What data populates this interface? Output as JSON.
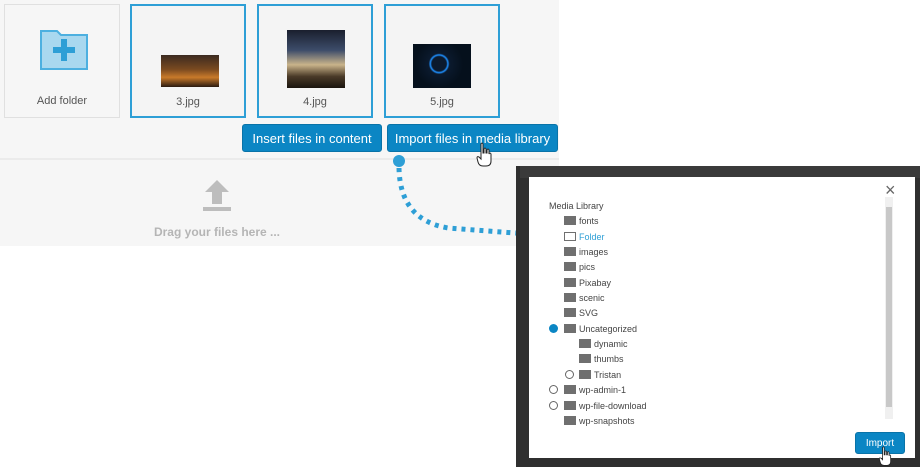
{
  "tiles": {
    "add_folder": "Add folder",
    "files": [
      "3.jpg",
      "4.jpg",
      "5.jpg"
    ]
  },
  "buttons": {
    "insert": "Insert files in content",
    "import_media": "Import files in media library"
  },
  "dropzone": {
    "text": "Drag your files here ..."
  },
  "dialog": {
    "close": "×",
    "tree": {
      "root": "Media Library",
      "items": [
        {
          "label": "fonts"
        },
        {
          "label": "Folder"
        },
        {
          "label": "images"
        },
        {
          "label": "pics"
        },
        {
          "label": "Pixabay"
        },
        {
          "label": "scenic"
        },
        {
          "label": "SVG"
        },
        {
          "label": "Uncategorized"
        },
        {
          "label": "dynamic"
        },
        {
          "label": "thumbs"
        },
        {
          "label": "Tristan"
        },
        {
          "label": "wp-admin-1"
        },
        {
          "label": "wp-file-download"
        },
        {
          "label": "wp-snapshots"
        }
      ]
    },
    "import_button": "Import"
  },
  "colors": {
    "accent": "#0b86c4",
    "selected_border": "#2e9fd6",
    "link": "#2e9fd6"
  }
}
